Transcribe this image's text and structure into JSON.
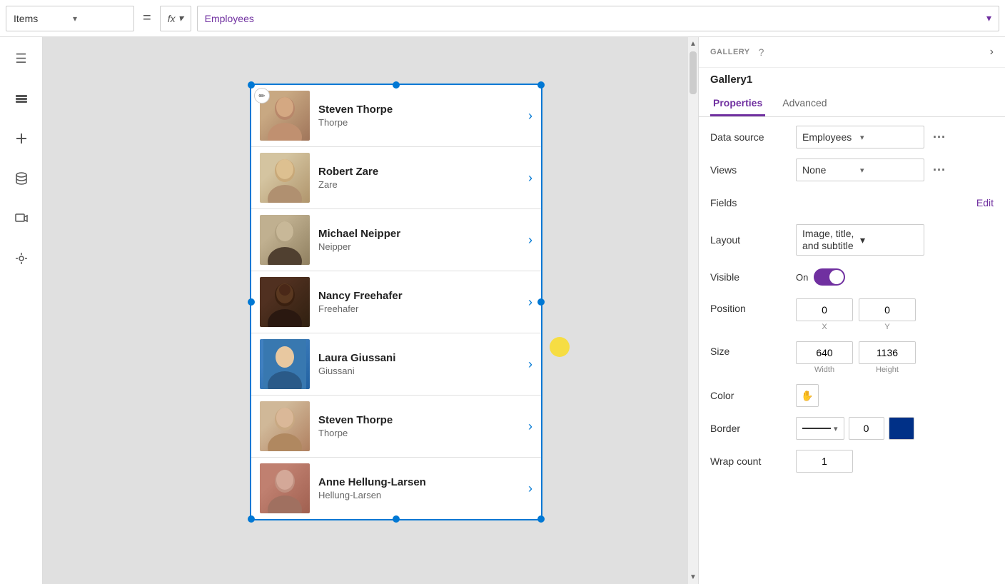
{
  "topbar": {
    "items_label": "Items",
    "equals": "=",
    "fx_label": "fx",
    "formula": "Employees",
    "formula_chevron": "▾"
  },
  "sidebar": {
    "icons": [
      {
        "name": "hamburger-icon",
        "glyph": "☰"
      },
      {
        "name": "layers-icon",
        "glyph": "⊞"
      },
      {
        "name": "add-icon",
        "glyph": "+"
      },
      {
        "name": "database-icon",
        "glyph": "🗃"
      },
      {
        "name": "media-icon",
        "glyph": "▶"
      },
      {
        "name": "tools-icon",
        "glyph": "🔧"
      }
    ]
  },
  "gallery": {
    "name": "Gallery1",
    "items": [
      {
        "id": 1,
        "name": "Steven Thorpe",
        "subtitle": "Thorpe",
        "avatar_class": "avatar-steven1"
      },
      {
        "id": 2,
        "name": "Robert Zare",
        "subtitle": "Zare",
        "avatar_class": "avatar-robert"
      },
      {
        "id": 3,
        "name": "Michael Neipper",
        "subtitle": "Neipper",
        "avatar_class": "avatar-michael"
      },
      {
        "id": 4,
        "name": "Nancy Freehafer",
        "subtitle": "Freehafer",
        "avatar_class": "avatar-nancy"
      },
      {
        "id": 5,
        "name": "Laura Giussani",
        "subtitle": "Giussani",
        "avatar_class": "avatar-laura"
      },
      {
        "id": 6,
        "name": "Steven Thorpe",
        "subtitle": "Thorpe",
        "avatar_class": "avatar-steven2"
      },
      {
        "id": 7,
        "name": "Anne Hellung-Larsen",
        "subtitle": "Hellung-Larsen",
        "avatar_class": "avatar-anne"
      }
    ]
  },
  "panel": {
    "section_label": "GALLERY",
    "help": "?",
    "component_name": "Gallery1",
    "tabs": [
      {
        "label": "Properties",
        "active": true
      },
      {
        "label": "Advanced",
        "active": false
      }
    ],
    "properties": {
      "data_source_label": "Data source",
      "data_source_value": "Employees",
      "views_label": "Views",
      "views_value": "None",
      "fields_label": "Fields",
      "fields_edit": "Edit",
      "layout_label": "Layout",
      "layout_value": "Image, title, and subtitle",
      "visible_label": "Visible",
      "visible_on": "On",
      "position_label": "Position",
      "pos_x": "0",
      "pos_y": "0",
      "pos_x_label": "X",
      "pos_y_label": "Y",
      "size_label": "Size",
      "size_width": "640",
      "size_height": "1136",
      "size_width_label": "Width",
      "size_height_label": "Height",
      "color_label": "Color",
      "color_icon": "✋",
      "border_label": "Border",
      "border_width": "0",
      "wrap_count_label": "Wrap count",
      "wrap_count_value": "1"
    }
  }
}
